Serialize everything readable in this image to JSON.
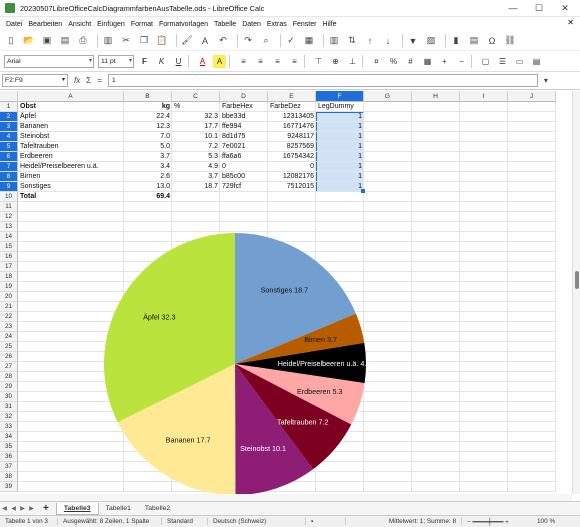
{
  "window": {
    "title": "20230507LibreOfficeCalcDiagrammfarbenAusTabelle.ods - LibreOffice Calc",
    "minimize": "—",
    "maximize": "☐",
    "close": "✕"
  },
  "menu": [
    "Datei",
    "Bearbeiten",
    "Ansicht",
    "Einfügen",
    "Format",
    "Formatvorlagen",
    "Tabelle",
    "Daten",
    "Extras",
    "Fenster",
    "Hilfe"
  ],
  "menu_close": "✕",
  "toolbar_icons": [
    "new-icon",
    "open-icon",
    "save-icon",
    "export-pdf-icon",
    "print-icon",
    "print-preview-icon",
    "cut-icon",
    "copy-icon",
    "paste-icon",
    "clone-formatting-icon",
    "clear-formatting-icon",
    "undo-icon",
    "redo-icon",
    "find-replace-icon",
    "spelling-icon",
    "row-icon",
    "column-icon",
    "sort-icon",
    "sort-ascending-icon",
    "sort-descending-icon",
    "autofilter-icon",
    "image-icon",
    "chart-icon",
    "pivot-table-icon",
    "special-character-icon",
    "hyperlink-icon"
  ],
  "format": {
    "font_name": "Arial",
    "font_size": "11 pt",
    "bold": "F",
    "italic": "K",
    "underline": "U",
    "font_color": "A",
    "highlight": "A"
  },
  "formula": {
    "namebox": "F2:F9",
    "fx": "fx",
    "sigma": "Σ",
    "equals": "=",
    "value": "1"
  },
  "columns": [
    "A",
    "B",
    "C",
    "D",
    "E",
    "F",
    "G",
    "H",
    "I",
    "J"
  ],
  "selected_column": "F",
  "rows": [
    "1",
    "2",
    "3",
    "4",
    "5",
    "6",
    "7",
    "8",
    "9",
    "10",
    "11",
    "12",
    "13",
    "14",
    "15",
    "16",
    "17",
    "18",
    "19",
    "20",
    "21",
    "22",
    "23",
    "24",
    "25",
    "26",
    "27",
    "28",
    "29",
    "30",
    "31",
    "32",
    "33",
    "34",
    "35",
    "36",
    "37",
    "38",
    "39"
  ],
  "headers": {
    "a": "Obst",
    "b": "kg",
    "c": "%",
    "d": "FarbeHex",
    "e": "FarbeDez",
    "f": "LegDummy"
  },
  "data_rows": [
    {
      "a": "Äpfel",
      "b": "22.4",
      "c": "32.3",
      "d": "bbe33d",
      "e": "12313405",
      "f": "1"
    },
    {
      "a": "Bananen",
      "b": "12.3",
      "c": "17.7",
      "d": "ffe994",
      "e": "16771476",
      "f": "1"
    },
    {
      "a": "Steinobst",
      "b": "7.0",
      "c": "10.1",
      "d": "8d1d75",
      "e": "9248117",
      "f": "1"
    },
    {
      "a": "Tafeltrauben",
      "b": "5.0",
      "c": "7.2",
      "d": "7e0021",
      "e": "8257569",
      "f": "1"
    },
    {
      "a": "Erdbeeren",
      "b": "3.7",
      "c": "5.3",
      "d": "ffa6a6",
      "e": "16754342",
      "f": "1"
    },
    {
      "a": "Heidel/Preiselbeeren u.ä.",
      "b": "3.4",
      "c": "4.9",
      "d": "0",
      "e": "0",
      "f": "1"
    },
    {
      "a": "Birnen",
      "b": "2.6",
      "c": "3.7",
      "d": "b85c00",
      "e": "12082176",
      "f": "1"
    },
    {
      "a": "Sonstiges",
      "b": "13.0",
      "c": "18.7",
      "d": "729fcf",
      "e": "7512015",
      "f": "1"
    }
  ],
  "total": {
    "a": "Total",
    "b": "69.4"
  },
  "chart_data": {
    "type": "pie",
    "title": "",
    "slices": [
      {
        "label": "Äpfel 32.3",
        "value": 32.3,
        "color": "#bbe33d",
        "text_color": "#111111"
      },
      {
        "label": "Bananen 17.7",
        "value": 17.7,
        "color": "#ffe994",
        "text_color": "#111111"
      },
      {
        "label": "Steinobst 10.1",
        "value": 10.1,
        "color": "#8d1d75",
        "text_color": "#ffffff"
      },
      {
        "label": "Tafeltrauben 7.2",
        "value": 7.2,
        "color": "#7e0021",
        "text_color": "#ffffff"
      },
      {
        "label": "Erdbeeren 5.3",
        "value": 5.3,
        "color": "#ffa6a6",
        "text_color": "#111111"
      },
      {
        "label": "Heidel/Preiselbeeren u.ä. 4.9",
        "value": 4.9,
        "color": "#000000",
        "text_color": "#ffffff"
      },
      {
        "label": "Birnen 3.7",
        "value": 3.7,
        "color": "#b85c00",
        "text_color": "#111111"
      },
      {
        "label": "Sonstiges 18.7",
        "value": 18.7,
        "color": "#729fcf",
        "text_color": "#111111"
      }
    ]
  },
  "sheets": {
    "add": "+",
    "tabs": [
      "Tabelle3",
      "Tabelle1",
      "Tabelle2"
    ],
    "active": "Tabelle3"
  },
  "status": {
    "sheet": "Tabelle 1 von 3",
    "selection": "Ausgewählt: 8 Zeilen, 1 Spalte",
    "style": "Standard",
    "language": "Deutsch (Schweiz)",
    "sum": "Mittelwert: 1; Summe: 8",
    "zoom": "100 %"
  },
  "colors": {
    "selection": "#cfe2f8",
    "header_selected": "#1e6fd9"
  }
}
